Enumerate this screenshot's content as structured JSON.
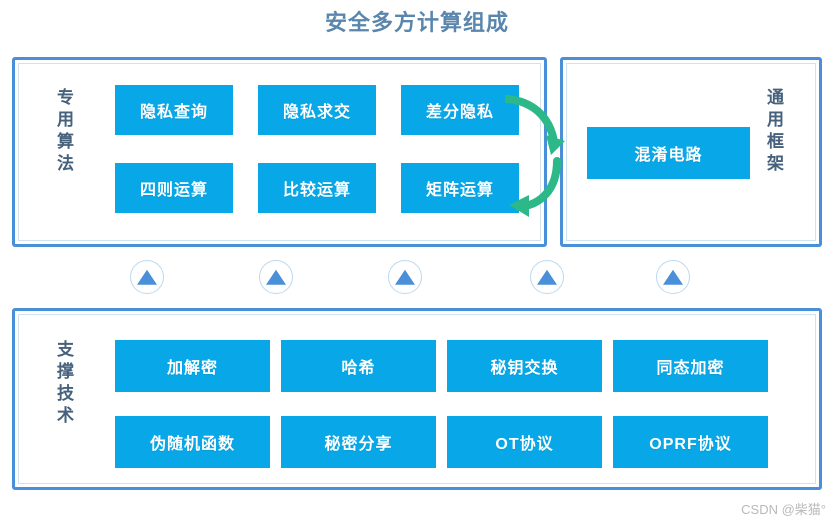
{
  "title": "安全多方计算组成",
  "colors": {
    "title_text": "#5a86ad",
    "panel_border": "#4a90d9",
    "box_fill": "#08a8e8",
    "box_text": "#ffffff",
    "arrow_green": "#2db888",
    "connector_ring": "#bcd9ef",
    "connector_triangle": "#4a90d9",
    "watermark_text": "#b9b9b9"
  },
  "panels": {
    "special_algorithms": {
      "side_label": "专用算法",
      "boxes": [
        {
          "label": "隐私查询"
        },
        {
          "label": "隐私求交"
        },
        {
          "label": "差分隐私"
        },
        {
          "label": "四则运算"
        },
        {
          "label": "比较运算"
        },
        {
          "label": "矩阵运算"
        }
      ]
    },
    "general_framework": {
      "side_label": "通用框架",
      "boxes": [
        {
          "label": "混淆电路"
        }
      ]
    },
    "support_technology": {
      "side_label": "支撑技术",
      "boxes": [
        {
          "label": "加解密"
        },
        {
          "label": "哈希"
        },
        {
          "label": "秘钥交换"
        },
        {
          "label": "同态加密"
        },
        {
          "label": "伪随机函数"
        },
        {
          "label": "秘密分享"
        },
        {
          "label": "OT协议"
        },
        {
          "label": "OPRF协议"
        }
      ]
    }
  },
  "connectors": {
    "count": 5,
    "icon": "triangle-up-icon"
  },
  "exchange_arrows": {
    "top_arrow": "curved-arrow-right-icon",
    "bottom_arrow": "curved-arrow-left-icon"
  },
  "watermark": "CSDN @柴猫°"
}
